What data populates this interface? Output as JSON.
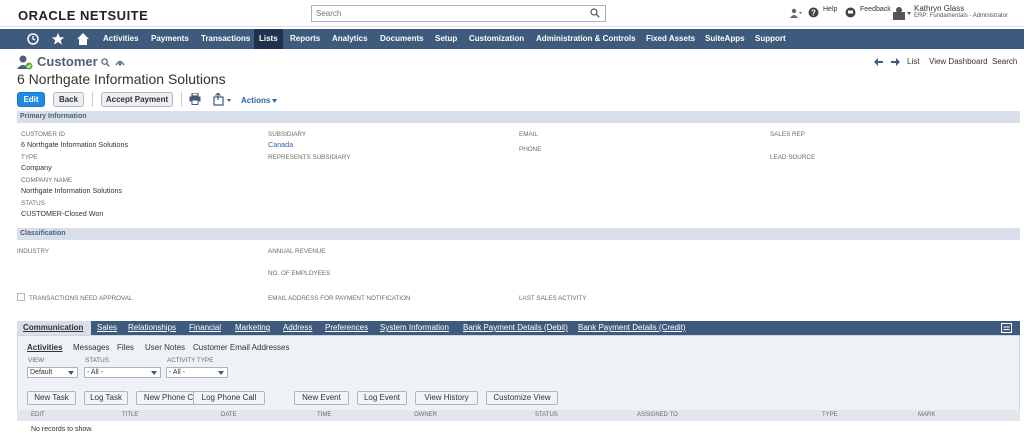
{
  "brand": {
    "oracle": "ORACLE",
    "netsuite": "NETSUITE"
  },
  "search": {
    "placeholder": "Search"
  },
  "top_right": {
    "help": "Help",
    "feedback": "Feedback",
    "user_name": "Kathryn Glass",
    "user_role": "ERP: Fundamentals - Administrator"
  },
  "nav": {
    "items": [
      "Activities",
      "Payments",
      "Transactions",
      "Lists",
      "Reports",
      "Analytics",
      "Documents",
      "Setup",
      "Customization",
      "Administration & Controls",
      "Fixed Assets",
      "SuiteApps",
      "Support"
    ],
    "active": "Lists"
  },
  "page": {
    "type_title": "Customer",
    "record_name": "6 Northgate Information Solutions"
  },
  "record_nav": {
    "list": "List",
    "view_dashboard": "View Dashboard",
    "search": "Search"
  },
  "actions": {
    "edit": "Edit",
    "back": "Back",
    "accept_payment": "Accept Payment",
    "actions": "Actions"
  },
  "primary": {
    "title": "Primary Information",
    "customer_id_label": "CUSTOMER ID",
    "customer_id": "6 Northgate Information Solutions",
    "type_label": "TYPE",
    "type": "Company",
    "company_name_label": "COMPANY NAME",
    "company_name": "Northgate Information Solutions",
    "status_label": "STATUS",
    "status": "CUSTOMER-Closed Won",
    "subsidiary_label": "SUBSIDIARY",
    "subsidiary": "Canada",
    "represents_label": "REPRESENTS SUBSIDIARY",
    "email_label": "EMAIL",
    "phone_label": "PHONE",
    "sales_rep_label": "SALES REP",
    "lead_source_label": "LEAD SOURCE"
  },
  "classification": {
    "title": "Classification",
    "industry_label": "INDUSTRY",
    "annual_revenue_label": "ANNUAL REVENUE",
    "employees_label": "NO. OF EMPLOYEES",
    "trans_approval_label": "TRANSACTIONS NEED APPROVAL",
    "email_payment_label": "EMAIL ADDRESS FOR PAYMENT NOTIFICATION",
    "last_sales_label": "LAST SALES ACTIVITY"
  },
  "tabs": [
    "Communication",
    "Sales",
    "Relationships",
    "Financial",
    "Marketing",
    "Address",
    "Preferences",
    "System Information",
    "Bank Payment Details (Debit)",
    "Bank Payment Details (Credit)"
  ],
  "subtabs": [
    "Activities",
    "Messages",
    "Files",
    "User Notes",
    "Customer Email Addresses"
  ],
  "filters": {
    "view_label": "VIEW",
    "view_value": "Default",
    "status_label": "STATUS",
    "status_value": "- All -",
    "activity_label": "ACTIVITY TYPE",
    "activity_value": "- All -"
  },
  "activity_buttons": [
    "New Task",
    "Log Task",
    "New Phone Call",
    "Log Phone Call",
    "New Event",
    "Log Event",
    "View History",
    "Customize View"
  ],
  "columns": [
    "EDIT",
    "TITLE",
    "DATE",
    "TIME",
    "OWNER",
    "STATUS",
    "ASSIGNED TO",
    "TYPE",
    "MARK"
  ],
  "empty": "No records to show.",
  "colors": {
    "nav": "#3e5a7c",
    "active_nav": "#1f3350",
    "primary_button": "#1e8be3",
    "section": "#d8dfea"
  }
}
